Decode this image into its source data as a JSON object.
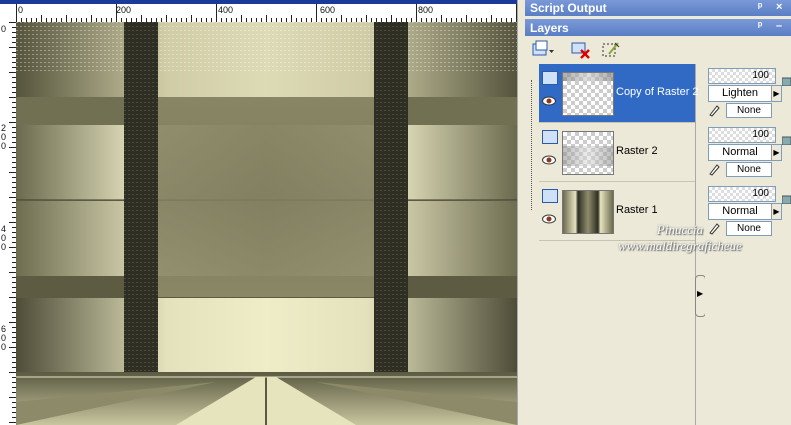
{
  "rulers": {
    "horizontal": [
      "0",
      "200",
      "400",
      "600",
      "800"
    ],
    "vertical": [
      {
        "label": "0"
      },
      {
        "label": "2\n0\n0"
      },
      {
        "label": "4\n0\n0"
      },
      {
        "label": "6\n0\n0"
      }
    ]
  },
  "panels": {
    "script_output": {
      "title": "Script Output",
      "pin": "ᵖ",
      "close": "×"
    },
    "layers": {
      "title": "Layers",
      "pin": "ᵖ",
      "close": "–"
    }
  },
  "toolbar": {
    "new_layer_icon": "new-raster-layer-icon",
    "delete_icon": "delete-layer-icon",
    "edit_selection_icon": "edit-selection-icon"
  },
  "layers": [
    {
      "name": "Copy of Raster 2",
      "opacity": "100",
      "blend_mode": "Lighten",
      "mask": "None",
      "selected": true
    },
    {
      "name": "Raster 2",
      "opacity": "100",
      "blend_mode": "Normal",
      "mask": "None",
      "selected": false
    },
    {
      "name": "Raster 1",
      "opacity": "100",
      "blend_mode": "Normal",
      "mask": "None",
      "selected": false
    }
  ],
  "watermark": {
    "line1": "Pinuccia",
    "line2": "www.maldiregraficheue"
  },
  "colors": {
    "titlebar": "#5a7ec4",
    "selection": "#316AC5",
    "panel_bg": "#ECE9D8"
  }
}
